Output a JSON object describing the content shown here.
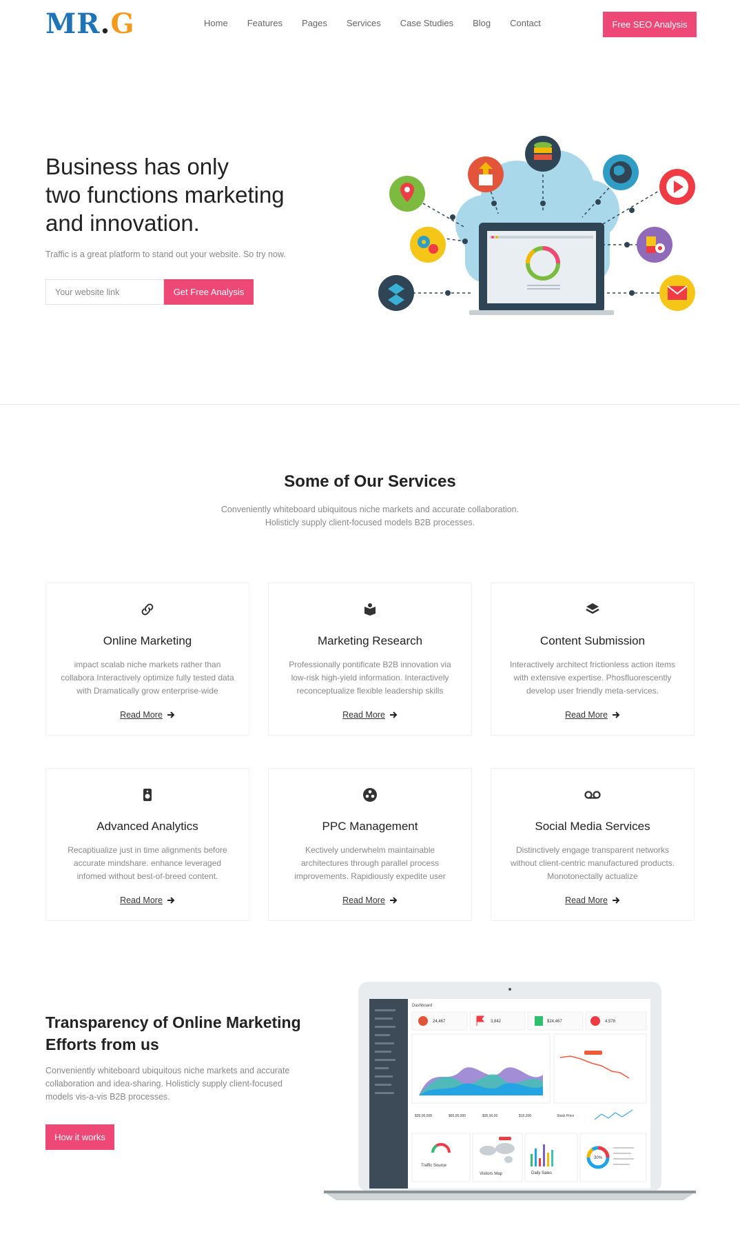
{
  "logo": {
    "mr": "MR",
    "dot": ".",
    "g": "G"
  },
  "nav": {
    "items": [
      "Home",
      "Features",
      "Pages",
      "Services",
      "Case Studies",
      "Blog",
      "Contact"
    ]
  },
  "header": {
    "cta_label": "Free SEO Analysis"
  },
  "hero": {
    "title_lines": [
      "Business has only",
      "two functions marketing",
      "and innovation."
    ],
    "subtitle": "Traffic is a great platform to stand out your website. So try now.",
    "input_placeholder": "Your website link",
    "button_label": "Get Free Analysis"
  },
  "services": {
    "title": "Some of Our Services",
    "subtitle_lines": [
      "Conveniently whiteboard ubiquitous niche markets and accurate collaboration.",
      "Holisticly supply client-focused models B2B processes."
    ],
    "read_more": "Read More",
    "cards": [
      {
        "icon": "link-icon",
        "title": "Online Marketing",
        "desc": [
          "impact scalab niche markets rather than",
          "collabora Interactively optimize fully tested data",
          "with Dramatically grow enterprise-wide"
        ]
      },
      {
        "icon": "book-icon",
        "title": "Marketing Research",
        "desc": [
          "Professionally pontificate B2B innovation via",
          "low-risk high-yield information. Interactively",
          "reconceptualize flexible leadership skills"
        ]
      },
      {
        "icon": "layers-icon",
        "title": "Content Submission",
        "desc": [
          "Interactively architect frictionless action items",
          "with extensive expertise. Phosfluorescently",
          "develop user friendly meta-services."
        ]
      },
      {
        "icon": "speaker-icon",
        "title": "Advanced Analytics",
        "desc": [
          "Recaptiualize just in time alignments before",
          "accurate mindshare. enhance leveraged",
          "infomed without best-of-breed content."
        ]
      },
      {
        "icon": "film-reel-icon",
        "title": "PPC Management",
        "desc": [
          "Kectively underwhelm maintainable",
          "architectures through parallel process",
          "improvements. Rapidiously expedite user"
        ]
      },
      {
        "icon": "voicemail-icon",
        "title": "Social Media Services",
        "desc": [
          "Distinctively engage transparent networks",
          "without client-centric manufactured products.",
          "Monotonectally actualize"
        ]
      }
    ]
  },
  "transparency": {
    "title_lines": [
      "Transparency of Online Marketing",
      "Efforts from us"
    ],
    "desc_lines": [
      "Conveniently whiteboard ubiquitous niche markets and accurate",
      "collaboration and idea-sharing. Holisticly supply client-focused",
      "models vis-a-vis B2B processes."
    ],
    "button_label": "How it works"
  },
  "dashboard": {
    "heading": "Dashboard",
    "stats": [
      "24,467",
      "3,842",
      "$24,467",
      "4,578"
    ],
    "bottom_stats": [
      "$35,00,000",
      "$65,00,000",
      "$35,00,00",
      "$15,200"
    ],
    "panel_labels": [
      "Traffic Source",
      "Visitors Map",
      "Daily Sales",
      "Stock Price"
    ],
    "donut_value": "30%"
  },
  "colors": {
    "accent": "#ee4877",
    "logo_blue": "#1f74b8",
    "logo_orange": "#f39a1e",
    "text": "#222222",
    "muted": "#888888"
  }
}
